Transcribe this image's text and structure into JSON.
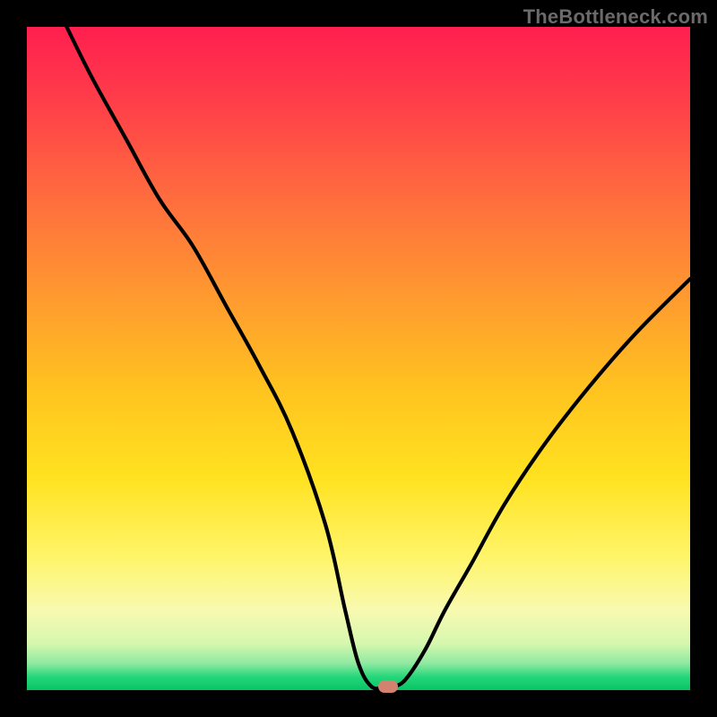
{
  "watermark": "TheBottleneck.com",
  "marker": {
    "color": "#d48270",
    "x_frac": 0.545,
    "y_frac": 0.995
  },
  "chart_data": {
    "type": "line",
    "title": "",
    "xlabel": "",
    "ylabel": "",
    "xlim": [
      0,
      100
    ],
    "ylim": [
      0,
      100
    ],
    "grid": false,
    "legend": false,
    "series": [
      {
        "name": "bottleneck-curve",
        "x": [
          6,
          10,
          15,
          20,
          25,
          30,
          35,
          40,
          45,
          48,
          50,
          52,
          54,
          55,
          57,
          60,
          63,
          67,
          72,
          78,
          85,
          92,
          100
        ],
        "y": [
          100,
          92,
          83,
          74,
          67,
          58,
          49,
          39,
          25,
          12,
          4,
          0.5,
          0.5,
          0.5,
          1.5,
          6,
          12,
          19,
          28,
          37,
          46,
          54,
          62
        ]
      }
    ],
    "marker_point": {
      "x": 54.5,
      "y": 0.5
    },
    "annotations": [
      {
        "text": "TheBottleneck.com",
        "role": "watermark",
        "position": "top-right"
      }
    ]
  }
}
